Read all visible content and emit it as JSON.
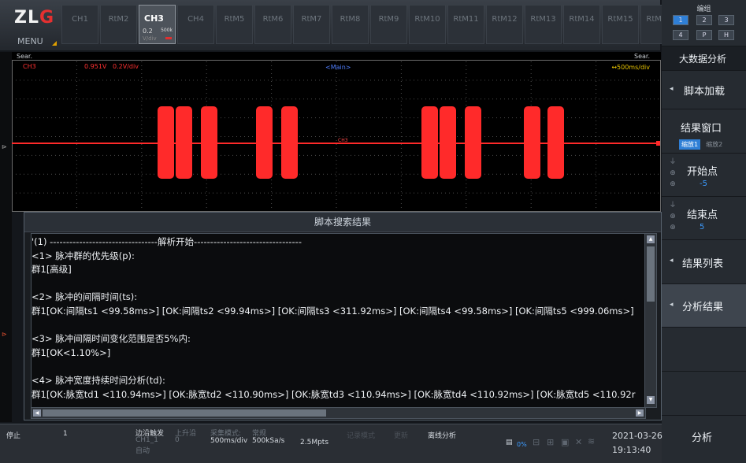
{
  "logo": {
    "brand": "ZLG",
    "menu_label": "MENU"
  },
  "channel_tabs": [
    {
      "label": "CH1"
    },
    {
      "label": "RtM2"
    },
    {
      "label": "CH3",
      "active": true,
      "scale": "0.2",
      "rate": "500k",
      "unit": "V/div"
    },
    {
      "label": "CH4"
    },
    {
      "label": "RtM5"
    },
    {
      "label": "RtM6"
    },
    {
      "label": "RtM7"
    },
    {
      "label": "RtM8"
    },
    {
      "label": "RtM9"
    },
    {
      "label": "RtM10"
    },
    {
      "label": "RtM11"
    },
    {
      "label": "RtM12"
    },
    {
      "label": "RtM13"
    },
    {
      "label": "RtM14"
    },
    {
      "label": "RtM15"
    },
    {
      "label": "RtM16"
    }
  ],
  "group": {
    "title": "编组",
    "buttons": [
      {
        "label": "1",
        "active": true
      },
      {
        "label": "2"
      },
      {
        "label": "3"
      },
      {
        "label": "4"
      },
      {
        "label": "P"
      },
      {
        "label": "H"
      }
    ]
  },
  "right_panel": {
    "header": "大数据分析",
    "script_load": "脚本加载",
    "result_window": "结果窗口",
    "zoom1": "缩放1",
    "zoom2": "缩放2",
    "start_point": "开始点",
    "start_value": "-5",
    "end_point": "结束点",
    "end_value": "5",
    "result_list": "结果列表",
    "analysis_result": "分析结果",
    "analyze": "分析"
  },
  "scope": {
    "search_left": "Sear.",
    "search_right": "Sear.",
    "channel": "CH3",
    "offset": "0.951V",
    "scale": "0.2V/div",
    "main_label": "<Main>",
    "timebase": "500ms/div",
    "trace_label": "CH3",
    "trace_color": "#ff2a2a"
  },
  "dialog": {
    "title": "脚本搜索结果",
    "lines": [
      "'(1) ---------------------------------解析开始---------------------------------",
      "<1> 脉冲群的优先级(p):",
      "群1[高级]",
      "",
      "<2> 脉冲的间隔时间(ts):",
      "群1[OK:间隔ts1 <99.58ms>]  [OK:间隔ts2 <99.94ms>]  [OK:间隔ts3 <311.92ms>]  [OK:间隔ts4 <99.58ms>]  [OK:间隔ts5 <999.06ms>]",
      "",
      "<3> 脉冲间隔时间变化范围是否5%内:",
      "群1[OK<1.10%>]",
      "",
      "<4> 脉冲宽度持续时间分析(td):",
      "群1[OK:脉宽td1 <110.94ms>]  [OK:脉宽td2 <110.90ms>]  [OK:脉宽td3 <110.94ms>]  [OK:脉宽td4 <110.92ms>]  [OK:脉宽td5 <110.92r"
    ]
  },
  "status": {
    "run_state": "停止",
    "count": "1",
    "trigger_type": "边沿触发",
    "trigger_source": "CH1_1",
    "trigger_mode": "自动",
    "trigger_edge": "上升沿",
    "trigger_level": "0",
    "acq_mode_label": "采集模式:",
    "acq_mode_value": "常规",
    "timebase": "500ms/div",
    "sample_rate": "500kSa/s",
    "memory_depth": "2.5Mpts",
    "record_mode": "记录模式",
    "update": "更新",
    "offline_analysis": "离线分析",
    "storage_percent": "0%",
    "date": "2021-03-26",
    "time": "19:13:40"
  }
}
